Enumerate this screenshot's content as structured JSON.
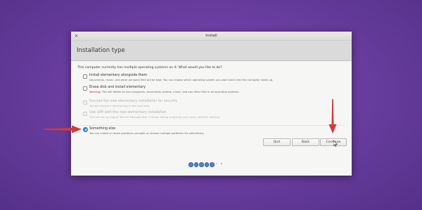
{
  "window": {
    "title": "Install",
    "close_glyph": "×"
  },
  "header": {
    "title": "Installation type"
  },
  "question": "This computer currently has multiple operating systems on it. What would you like to do?",
  "options": [
    {
      "label": "Install elementary alongside them",
      "description": "Documents, music, and other personal files will be kept. You can choose which operating system you want each time the computer starts up.",
      "type": "checkbox",
      "enabled": true,
      "selected": false
    },
    {
      "label": "Erase disk and install elementary",
      "warning_prefix": "Warning:",
      "description": "This will delete all your programs, documents, photos, music, and any other files in all operating systems.",
      "type": "checkbox",
      "enabled": true,
      "selected": false
    },
    {
      "label": "Encrypt the new elementary installation for security",
      "description": "You will choose a security key in the next step.",
      "type": "checkbox",
      "enabled": false,
      "selected": false
    },
    {
      "label": "Use LVM with the new elementary installation",
      "description": "This will set up Logical Volume Management. It allows taking snapshots and easier partition resizing.",
      "type": "checkbox",
      "enabled": false,
      "selected": false
    },
    {
      "label": "Something else",
      "description": "You can create or resize partitions yourself, or choose multiple partitions for elementary.",
      "type": "radio",
      "enabled": true,
      "selected": true
    }
  ],
  "buttons": {
    "quit": "Quit",
    "back": "Back",
    "continue": "Continue"
  },
  "progress": {
    "total_steps": 7,
    "filled_steps": 5
  },
  "colors": {
    "accent": "#3d8fd6",
    "warning": "#b02020",
    "annotation_arrow": "#d23a3a",
    "background": "#6a3ea0"
  }
}
